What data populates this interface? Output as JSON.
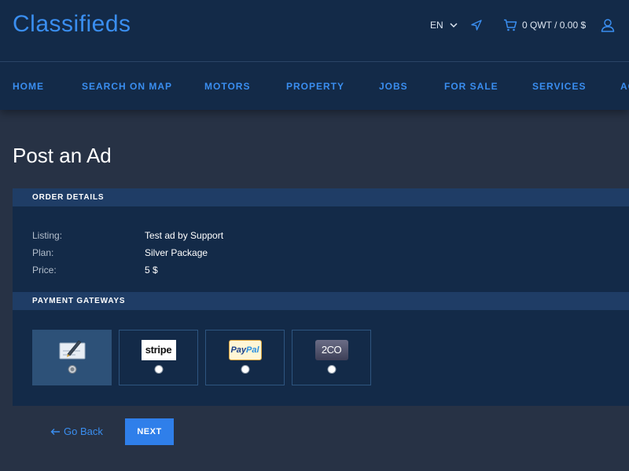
{
  "header": {
    "logo": "Classifieds",
    "lang": "EN",
    "cart_text": "0 QWT / 0.00 $"
  },
  "nav": {
    "items": [
      "HOME",
      "SEARCH ON MAP",
      "MOTORS",
      "PROPERTY",
      "JOBS",
      "FOR SALE",
      "SERVICES",
      "ACCOMMODATION"
    ]
  },
  "page": {
    "title": "Post an Ad"
  },
  "order_details": {
    "heading": "ORDER DETAILS",
    "rows": [
      {
        "label": "Listing:",
        "value": "Test ad by Support"
      },
      {
        "label": "Plan:",
        "value": "Silver Package"
      },
      {
        "label": "Price:",
        "value": "5 $"
      }
    ]
  },
  "payment": {
    "heading": "PAYMENT GATEWAYS",
    "gateways": [
      {
        "name": "check-icon",
        "selected": true
      },
      {
        "name": "stripe",
        "logo_text": "stripe",
        "selected": false
      },
      {
        "name": "paypal",
        "logo_text_a": "Pay",
        "logo_text_b": "Pal",
        "selected": false
      },
      {
        "name": "2checkout",
        "logo_text": "2CO",
        "selected": false
      }
    ]
  },
  "actions": {
    "back_label": "Go Back",
    "next_label": "NEXT"
  },
  "colors": {
    "accent": "#3a8ef0",
    "header_bg": "#132a48",
    "page_bg": "#273245",
    "button_bg": "#2f7fea"
  }
}
